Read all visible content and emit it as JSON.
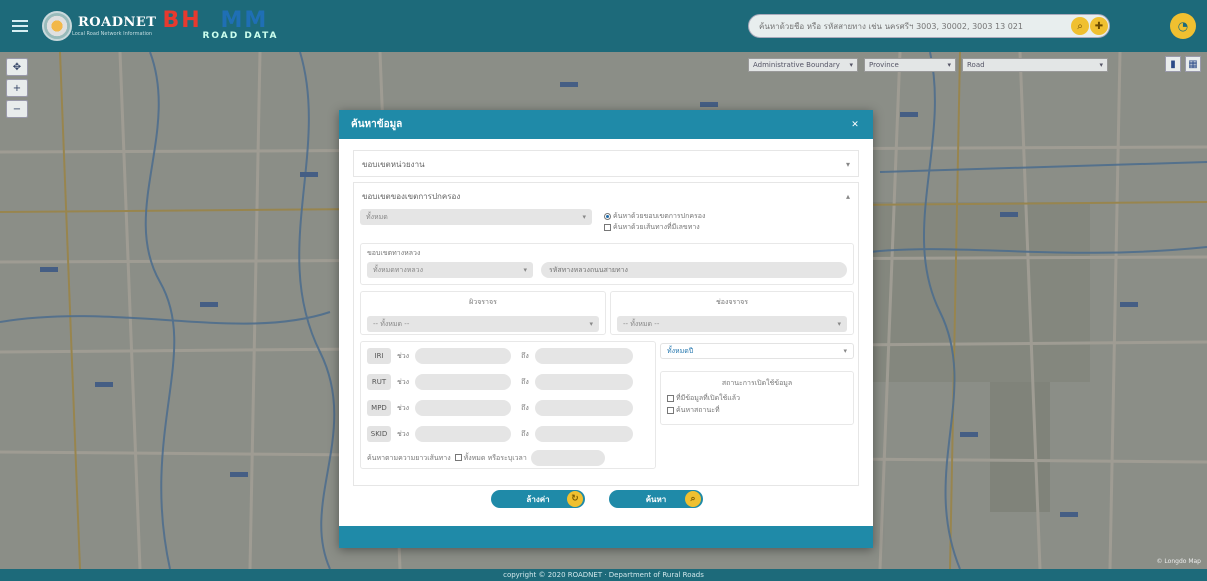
{
  "header": {
    "brand": "ROADNET",
    "brand_sub": "Local Road Network Information",
    "brand2_a": "BH",
    "brand2_b": "MM",
    "brand2_c": "ROAD DATA",
    "search_placeholder": "ค้นหาด้วยชื่อ หรือ รหัสสายทาง เช่น นครศรีฯ 3003, 30002, 3003 13 021"
  },
  "map": {
    "layer_select_1": "Administrative Boundary",
    "layer_select_2": "Province",
    "layer_select_3": "Road",
    "attribution": "© Longdo Map"
  },
  "modal": {
    "title": "ค้นหาข้อมูล",
    "section1": "ขอบเขตหน่วยงาน",
    "section2": "ขอบเขตของเขตการปกครอง",
    "select_all": "ทั้งหมด",
    "radio_admin": "ค้นหาด้วยขอบเขตการปกครอง",
    "radio_route": "ค้นหาด้วยเส้นทางที่มีเลขทาง",
    "road_group_label": "ขอบเขตทางหลวง",
    "road_type_select": "ทั้งหมดทางหลวง",
    "road_code_placeholder": "รหัสทางหลวงถนนสายทาง",
    "surface_label": "ผิวจราจร",
    "surface_select": "-- ทั้งหมด --",
    "lanes_label": "ช่องจราจร",
    "lanes_select": "-- ทั้งหมด --",
    "ranges": [
      {
        "name": "IRI",
        "from": "ช่วง",
        "to": "ถึง"
      },
      {
        "name": "RUT",
        "from": "ช่วง",
        "to": "ถึง"
      },
      {
        "name": "MPD",
        "from": "ช่วง",
        "to": "ถึง"
      },
      {
        "name": "SKID",
        "from": "ช่วง",
        "to": "ถึง"
      }
    ],
    "year_select": "ทั้งหมดปี",
    "usage_title": "สถานะการเปิดใช้ข้อมูล",
    "usage_opt1": "ที่มีข้อมูลที่เปิดใช้แล้ว",
    "usage_opt2": "ค้นหาสถานะที่",
    "length_label": "ค้นหาตามความยาวเส้นทาง",
    "length_all": "ทั้งหมด หรือระบุเวลา",
    "btn_reset": "ล้างค่า",
    "btn_search": "ค้นหา"
  },
  "footer": {
    "text": "copyright © 2020 ROADNET · Department of Rural Roads"
  }
}
